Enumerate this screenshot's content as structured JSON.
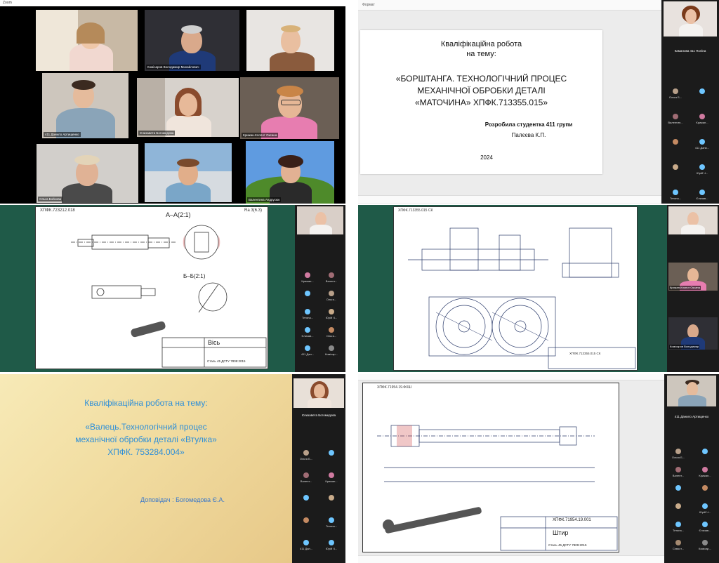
{
  "pane1": {
    "window_title": "Zoom",
    "participants": [
      {
        "name": ""
      },
      {
        "name": "Комісаров Володимир Михайлович"
      },
      {
        "name": ""
      },
      {
        "name": "411 Данило Артищенко"
      },
      {
        "name": "Єлизавета Богомедова"
      },
      {
        "name": "Крижан-Клопот Оксана"
      },
      {
        "name": "Ольга Бойкова"
      },
      {
        "name": ""
      },
      {
        "name": "Валентина Андрусюк"
      }
    ]
  },
  "pane2": {
    "toolbar_label": "Формат",
    "slide_title_line1": "Кваліфікаційна робота",
    "slide_title_line2": "на тему:",
    "slide_topic_line1": "«БОРШТАНГА. ТЕХНОЛОГІЧНИЙ ПРОЦЕС",
    "slide_topic_line2": "МЕХАНІЧНОЇ ОБРОБКИ ДЕТАЛІ",
    "slide_topic_line3": "«МАТОЧИНА» ХПФК.713355.015»",
    "author_line1": "Розробила студентка 411 групи",
    "author_line2": "Палєєва К.П.",
    "year": "2024",
    "side_speaker": "Камалова 411 Поліна",
    "attendees": [
      {
        "label": "Ольга Б..."
      },
      {
        "label": ""
      },
      {
        "label": "Валентин..."
      },
      {
        "label": "Крижан..."
      },
      {
        "label": ""
      },
      {
        "label": "411 Дани..."
      },
      {
        "label": ""
      },
      {
        "label": "Юрій Ч..."
      },
      {
        "label": "Тетяна..."
      },
      {
        "label": "Єлизав..."
      }
    ]
  },
  "pane3": {
    "stamp_top": "ХПФК.723212.018",
    "sheet_label": "Ra 3(6.3)",
    "section_aa": "А–А(2:1)",
    "section_bb": "Б–Б(2:1)",
    "part_name": "Вісь",
    "material": "Сталь 45 ДСТУ 7809:2015",
    "attendees": [
      {
        "label": "Крижан..."
      },
      {
        "label": "Валент..."
      },
      {
        "label": ""
      },
      {
        "label": "Ольга..."
      },
      {
        "label": "Тетяна..."
      },
      {
        "label": "Юрій Ч..."
      },
      {
        "label": "Єлизав..."
      },
      {
        "label": "Ольга..."
      },
      {
        "label": "411 Дан..."
      },
      {
        "label": "Комісар..."
      }
    ]
  },
  "pane4": {
    "stamp_top": "ХПФК.713355.015 СК",
    "stamp_bottom": "ХПФК.713355.015 СК",
    "side_cams": [
      {
        "name": ""
      },
      {
        "name": "Крижан-Клопот Оксана"
      },
      {
        "name": "Комісаров Володимир"
      }
    ]
  },
  "pane5": {
    "slide_title": "Кваліфікаційна робота на тему:",
    "topic_line1": "«Валець.Технологічний процес",
    "topic_line2": "механічної обробки деталі «Втулка»",
    "topic_line3": "ХПФК. 753284.004»",
    "presenter": "Доповідач : Богомедова Є.А.",
    "side_speaker": "Єлизавета Богомедова",
    "attendees": [
      {
        "label": "Ольга Б..."
      },
      {
        "label": ""
      },
      {
        "label": "Валент..."
      },
      {
        "label": "Крижан..."
      },
      {
        "label": ""
      },
      {
        "label": ""
      },
      {
        "label": ""
      },
      {
        "label": "Тетяна..."
      },
      {
        "label": "411 Дан..."
      },
      {
        "label": "Юрій Ч..."
      }
    ]
  },
  "pane6": {
    "stamp_top": "ХПФК.71954.19.ФХШ",
    "stamp_bottom": "ХПФК.71954.19.001",
    "part_name": "Штир",
    "material": "Сталь 45 ДСТУ 7809:2015",
    "side_speaker": "411 Данило Артищенко",
    "attendees": [
      {
        "label": "Ольга Б..."
      },
      {
        "label": ""
      },
      {
        "label": "Валент..."
      },
      {
        "label": "Крижан..."
      },
      {
        "label": ""
      },
      {
        "label": ""
      },
      {
        "label": ""
      },
      {
        "label": "Юрій Ч..."
      },
      {
        "label": "Тетяна..."
      },
      {
        "label": "Єлизав..."
      },
      {
        "label": "Сєвост..."
      },
      {
        "label": "Комісар..."
      }
    ]
  },
  "colors": {
    "cad_background": "#1f5a48",
    "slide_title_blue": "#2e8fd8",
    "presenter_blue": "#3a78c9",
    "avatar_blue": "#6ec6ff"
  }
}
